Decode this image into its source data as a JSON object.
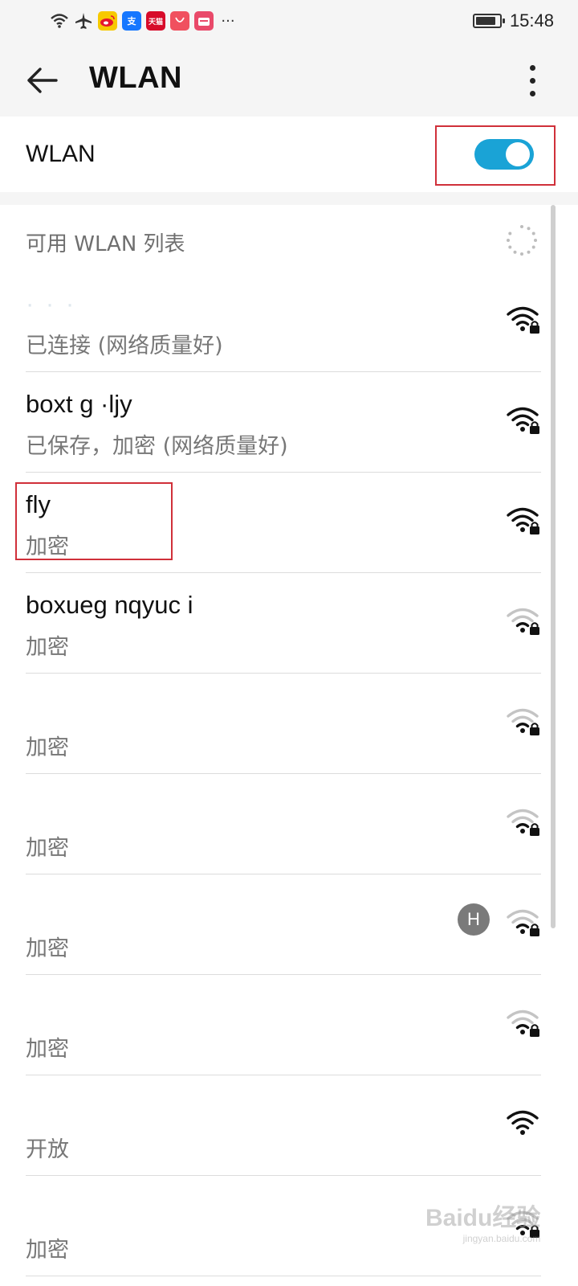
{
  "status_bar": {
    "icons": [
      "wifi-icon",
      "airplane-icon",
      "weibo-icon",
      "alipay-icon",
      "tmall-icon",
      "huawei-mall-icon",
      "video-app-icon",
      "more-notifications-icon"
    ],
    "app_badges": {
      "alipay": "支",
      "tmall": "天猫"
    },
    "more": "···",
    "battery_level": 0.85,
    "time": "15:48"
  },
  "app_bar": {
    "back_icon": "arrow-left-icon",
    "title": "WLAN",
    "menu_icon": "more-vertical-icon"
  },
  "wlan_toggle": {
    "label": "WLAN",
    "enabled": true,
    "accent_color": "#1aa3d6",
    "highlight_color": "#d0303a"
  },
  "available_networks": {
    "header": "可用 WLAN 列表",
    "scanning": true,
    "networks": [
      {
        "ssid": "· · ·",
        "ssid_obscured": true,
        "status": "已连接 (网络质量好)",
        "signal": "strong",
        "secured": true
      },
      {
        "ssid": "boxt  g   ·ljy",
        "ssid_obscured": false,
        "status": "已保存，加密 (网络质量好)",
        "signal": "strong",
        "secured": true
      },
      {
        "ssid": "fly",
        "ssid_obscured": false,
        "status": "加密",
        "signal": "strong",
        "secured": true,
        "highlighted": true
      },
      {
        "ssid": "boxueg   nqyuc  i",
        "ssid_obscured": false,
        "status": "加密",
        "signal": "medium",
        "secured": true
      },
      {
        "ssid": "",
        "ssid_obscured": true,
        "status": "加密",
        "signal": "medium",
        "secured": true
      },
      {
        "ssid": "",
        "ssid_obscured": true,
        "status": "加密",
        "signal": "medium",
        "secured": true
      },
      {
        "ssid": "",
        "ssid_obscured": true,
        "status": "加密",
        "signal": "medium",
        "secured": true,
        "badge": "H"
      },
      {
        "ssid": "",
        "ssid_obscured": true,
        "status": "加密",
        "signal": "medium",
        "secured": true
      },
      {
        "ssid": "",
        "ssid_obscured": true,
        "status": "开放",
        "signal": "strong",
        "secured": false
      },
      {
        "ssid": "",
        "ssid_obscured": true,
        "status": "加密",
        "signal": "medium",
        "secured": true
      }
    ]
  },
  "watermark": {
    "text": "Baidu经验",
    "sub": "jingyan.baidu.com"
  }
}
